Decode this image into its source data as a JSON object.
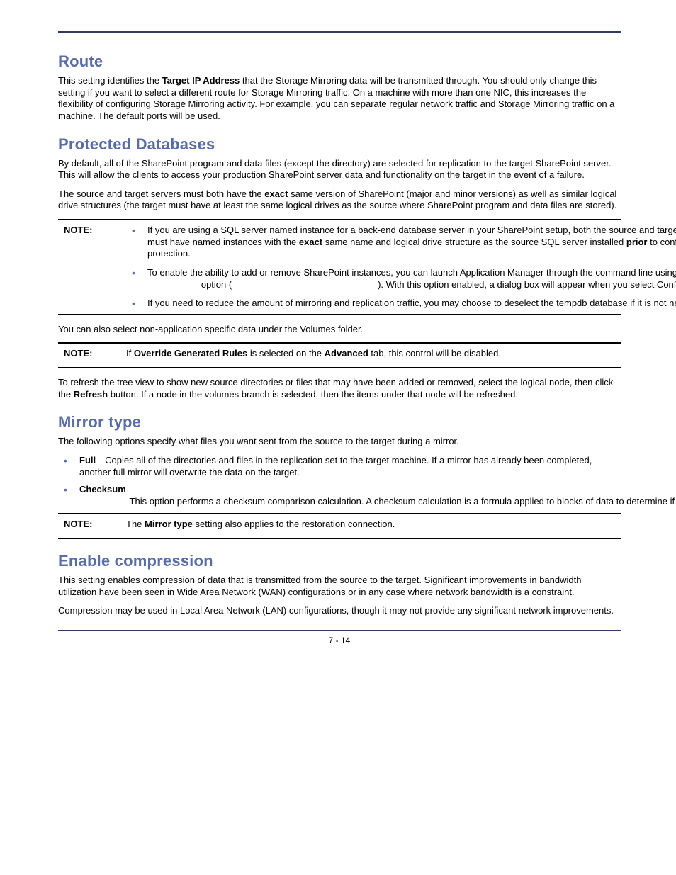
{
  "sections": {
    "route": {
      "heading": "Route",
      "p1_a": "This setting identifies the ",
      "p1_bold": "Target IP Address",
      "p1_b": " that the Storage Mirroring data will be transmitted through. You should only change this setting if you want to select a different route for Storage Mirroring traffic. On a machine with more than one NIC, this increases the flexibility of configuring Storage Mirroring activity. For example, you can separate regular network traffic and Storage Mirroring traffic on a machine. The default ports will be used."
    },
    "protected": {
      "heading": "Protected Databases",
      "p1": "By default, all of the SharePoint program and data files (except the              directory) are selected for replication to the target SharePoint server. This will allow the clients to access your production SharePoint server data and functionality on the target in the event of a failure.",
      "p2_a": "The source and target servers must both have the ",
      "p2_bold": "exact",
      "p2_b": " same version of SharePoint (major and minor versions) as well as similar logical drive structures (the target must have at least the same logical drives as the source where SharePoint program and data files are stored).",
      "note_label": "NOTE:",
      "note1_a": "If you are using a SQL server named instance for a back-end database server in your SharePoint setup, both the source and target SQL servers must have named instances with the ",
      "note1_bold1": "exact",
      "note1_b": " same name and logical drive structure as the source SQL server installed ",
      "note1_bold2": "prior",
      "note1_c": " to configuring protection.",
      "note2_a": "To enable the ability to add or remove SharePoint instances, you can launch Application Manager through the command line using the",
      "note2_option_prefix": "                     option (",
      "note2_option_suffix": "                                                         ). With this option enabled, a dialog box will appear when you select Configure Protection.",
      "note3": "If you need to reduce the amount of mirroring and replication traffic, you may choose to deselect the tempdb database if it is not necessary.",
      "after1": "You can also select non-application specific data under the Volumes folder.",
      "note4_a": "If ",
      "note4_bold1": "Override Generated Rules",
      "note4_b": " is selected on the ",
      "note4_bold2": "Advanced",
      "note4_c": " tab, this control will be disabled.",
      "after2_a": "To refresh the tree view to show new source directories or files that may have been added or removed, select the logical node, then click the ",
      "after2_bold": "Refresh",
      "after2_b": " button. If a node in the volumes branch is selected, then the items under that node will be refreshed."
    },
    "mirror": {
      "heading": "Mirror type",
      "p1": "The following options specify what files you want sent from the source to the target during a mirror.",
      "li1_bold": "Full",
      "li1_body": "—Copies all of the directories and files in the replication set to the target machine. If a mirror has already been completed, another full mirror will overwrite the data on the target.",
      "li2_bold": "Checksum",
      "li2_default_italic": "",
      "li2_body": "—                This option performs a checksum comparison calculation. A checksum calculation is a formula applied to blocks of data to determine if the binary make-up of the block is identical. If the checksums on the source and target machine are the same, the block is skipped. If the checksums on the source and target machine are not the same, the block on the source is sent to the target. With this option, the entire file is not overwritten; only the block that is received from the source is overwritten.",
      "note_label": "NOTE:",
      "note_a": "The ",
      "note_bold": "Mirror type",
      "note_b": " setting also applies to the restoration connection."
    },
    "compression": {
      "heading": "Enable compression",
      "p1": "This setting enables compression of data that is transmitted from the source to the target. Significant improvements in bandwidth utilization have been seen in Wide Area Network (WAN) configurations or in any case where network bandwidth is a constraint.",
      "p2": "Compression may be used in Local Area Network (LAN) configurations, though it may not provide any significant network improvements."
    }
  },
  "footer": {
    "page_number": "7 - 14"
  }
}
